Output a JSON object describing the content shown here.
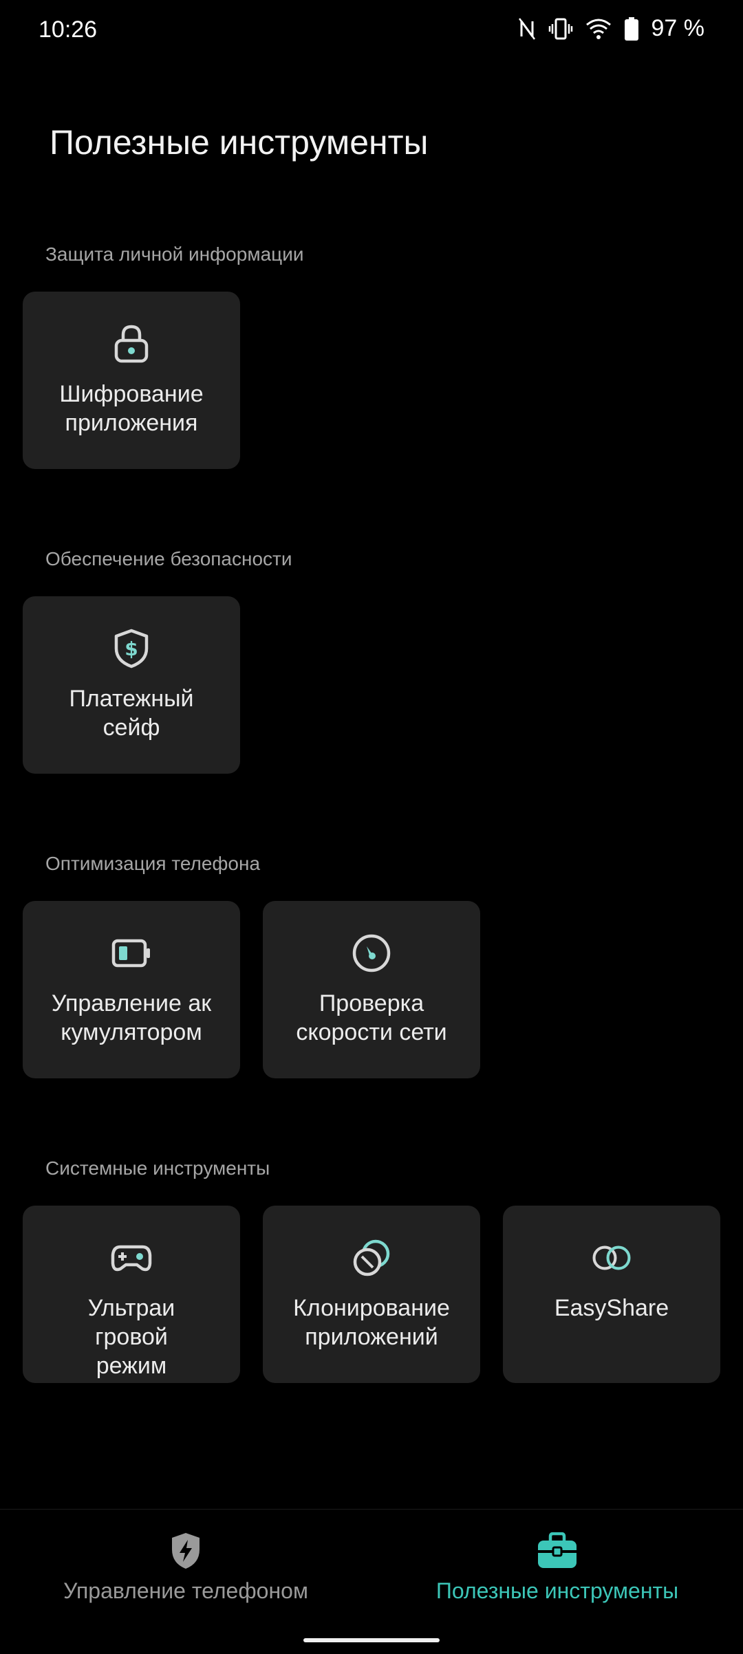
{
  "status_bar": {
    "time": "10:26",
    "battery_text": "97 %",
    "icons": [
      "nfc-icon",
      "vibrate-icon",
      "wifi-icon",
      "battery-icon"
    ]
  },
  "page": {
    "title": "Полезные инструменты"
  },
  "sections": [
    {
      "header": "Защита личной информации",
      "tiles": [
        {
          "label": "Шифрование\nприложения",
          "icon": "lock-icon"
        }
      ]
    },
    {
      "header": "Обеспечение безопасности",
      "tiles": [
        {
          "label": "Платежный\nсейф",
          "icon": "shield-dollar-icon"
        }
      ]
    },
    {
      "header": "Оптимизация телефона",
      "tiles": [
        {
          "label": "Управление ак\nкумулятором",
          "icon": "battery-icon"
        },
        {
          "label": "Проверка\nскорости сети",
          "icon": "speedometer-icon"
        }
      ]
    },
    {
      "header": "Системные инструменты",
      "tiles": [
        {
          "label": "Ультраи\nгровой\nрежим",
          "icon": "gamepad-icon"
        },
        {
          "label": "Клонирование\nприложений",
          "icon": "clone-icon"
        },
        {
          "label": "EasyShare",
          "icon": "link-rings-icon"
        }
      ]
    }
  ],
  "bottom_nav": {
    "items": [
      {
        "label": "Управление телефоном",
        "icon": "shield-bolt-icon",
        "active": false
      },
      {
        "label": "Полезные инструменты",
        "icon": "toolbox-icon",
        "active": true
      }
    ]
  },
  "colors": {
    "background": "#000000",
    "tile": "#212121",
    "accent": "#3cc6b8",
    "icon_accent": "#7ed9cf"
  }
}
